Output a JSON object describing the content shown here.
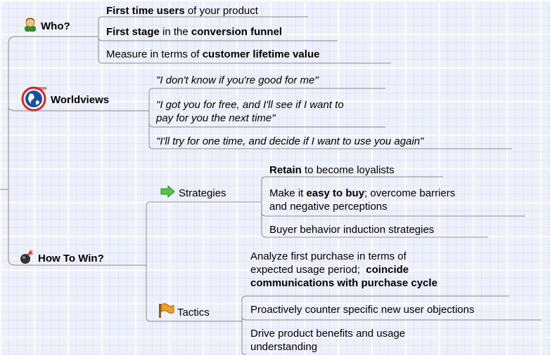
{
  "topics": {
    "who": {
      "label": "Who?",
      "icon": "person-icon",
      "items": [
        {
          "a": "First time users",
          "b": " of your product"
        },
        {
          "a": "First stage",
          "b": " in the ",
          "c": "conversion funnel"
        },
        {
          "a": "Measure in terms of ",
          "b": "customer lifetime value"
        }
      ]
    },
    "worldviews": {
      "label": "Worldviews",
      "icon": "globe-www-icon",
      "items": [
        {
          "line1": "\"I don't know if you're good for me\""
        },
        {
          "line1": "\"I got you for free, and I'll see if I want to",
          "line2": "pay for you the next time\""
        },
        {
          "line1": "\"I'll try for one time, and decide if I want to use you again\""
        }
      ]
    },
    "how_to_win": {
      "label": "How To Win?",
      "icon": "bomb-icon",
      "strategies": {
        "label": "Strategies",
        "icon": "green-arrow-icon",
        "items": [
          {
            "a": "Retain",
            "b": " to become loyalists"
          },
          {
            "a": "Make it ",
            "b": "easy to buy",
            "c": "; overcome barriers",
            "line2": "and negative perceptions"
          },
          {
            "a": "Buyer behavior induction strategies"
          }
        ]
      },
      "tactics": {
        "label": "Tactics",
        "icon": "flag-icon",
        "items": [
          {
            "line1": "Analyze first purchase in terms of",
            "line2a": "expected usage period;  ",
            "line2b": "coincide",
            "line3": "communications with purchase cycle"
          },
          {
            "line1": "Proactively counter specific new user objections"
          },
          {
            "line1": "Drive product benefits and usage",
            "line2": "understanding"
          }
        ]
      }
    }
  }
}
